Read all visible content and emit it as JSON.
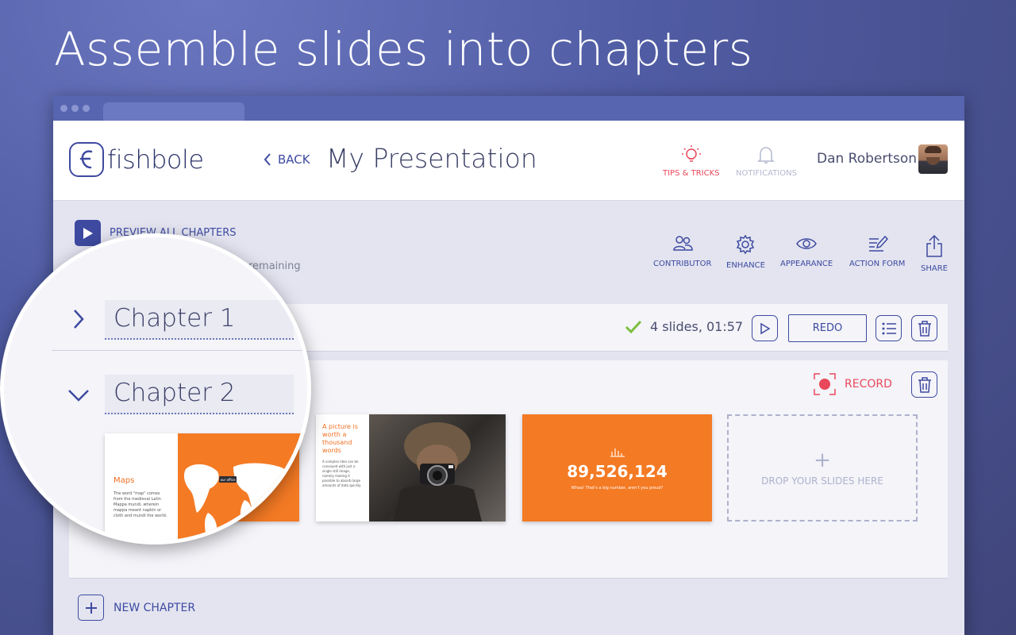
{
  "hero": {
    "title": "Assemble slides into chapters"
  },
  "app": {
    "logo_text": "fishbole",
    "back_label": "BACK",
    "presentation_title": "My Presentation",
    "tips_label": "TIPS & TRICKS",
    "notifications_label": "NOTIFICATIONS",
    "user_name": "Dan Robertson"
  },
  "toolbar": {
    "preview_label": "PREVIEW ALL CHAPTERS",
    "remaining_text": "remaining",
    "tools": [
      {
        "label": "CONTRIBUTOR",
        "icon": "contributor-icon"
      },
      {
        "label": "ENHANCE",
        "icon": "gear-icon"
      },
      {
        "label": "APPEARANCE",
        "icon": "eye-icon"
      },
      {
        "label": "ACTION FORM",
        "icon": "form-icon"
      },
      {
        "label": "SHARE",
        "icon": "share-icon"
      }
    ]
  },
  "chapters": [
    {
      "name": "Chapter 1",
      "status": "4 slides, 01:57",
      "redo_label": "REDO"
    },
    {
      "name": "Chapter 2",
      "record_label": "RECORD"
    }
  ],
  "slides": {
    "maps": {
      "title": "Maps",
      "body": "The word \"map\" comes from the medieval Latin Mappa mundi, wherein mappa meant napkin or cloth and mundi the world.",
      "tag": "our office"
    },
    "picture": {
      "title": "A picture is worth a thousand words",
      "body": "A complex idea can be conveyed with just a single still image, namely making it possible to absorb large amounts of data quickly."
    },
    "number": {
      "value": "89,526,124",
      "subtitle": "Whoa! That's a big number, aren't you proud?"
    },
    "drop_label": "DROP YOUR SLIDES HERE"
  },
  "new_chapter_label": "NEW CHAPTER",
  "colors": {
    "accent": "#3e4aa0",
    "orange": "#f47a24",
    "red": "#e9485a",
    "green": "#7cbf3f"
  }
}
